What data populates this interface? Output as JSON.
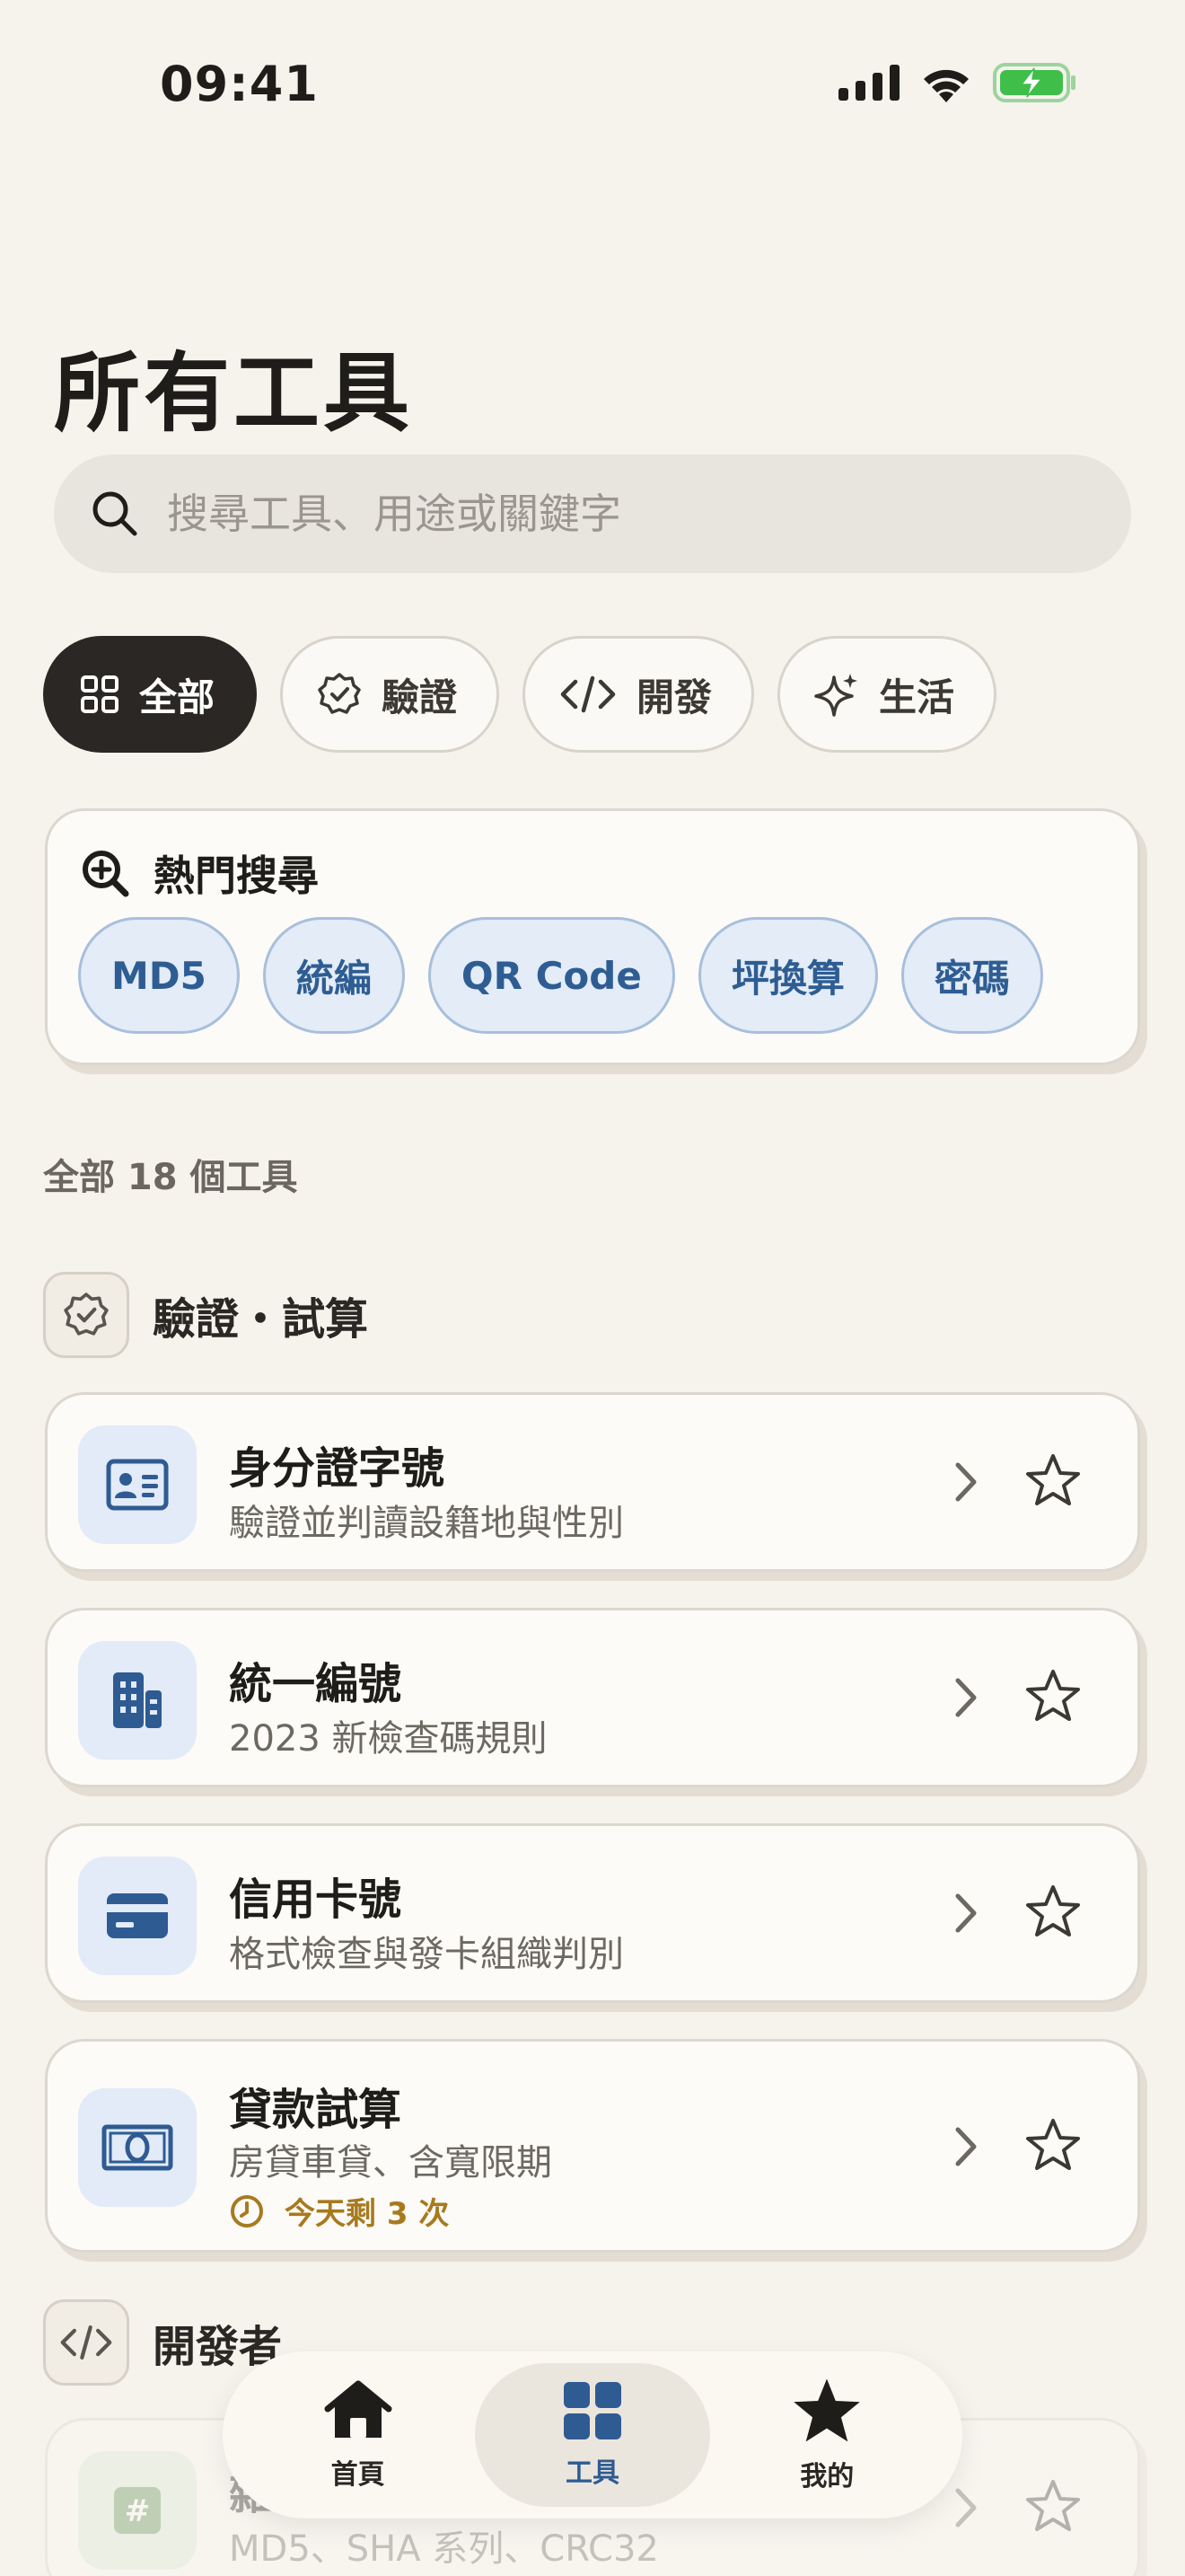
{
  "status": {
    "time": "09:41"
  },
  "page": {
    "title": "所有工具"
  },
  "search": {
    "placeholder": "搜尋工具、用途或關鍵字"
  },
  "filters": [
    {
      "label": "全部",
      "icon": "grid-icon",
      "active": true
    },
    {
      "label": "驗證",
      "icon": "badge-check-icon"
    },
    {
      "label": "開發",
      "icon": "code-icon"
    },
    {
      "label": "生活",
      "icon": "sparkle-icon"
    }
  ],
  "hot": {
    "title": "熱門搜尋",
    "tags": [
      "MD5",
      "統編",
      "QR Code",
      "坪換算",
      "密碼"
    ]
  },
  "count_label": "全部 18 個工具",
  "sections": [
    {
      "title": "驗證・試算",
      "tools": [
        {
          "title": "身分證字號",
          "subtitle": "驗證並判讀設籍地與性別",
          "icon": "id-card-icon"
        },
        {
          "title": "統一編號",
          "subtitle": "2023 新檢查碼規則",
          "icon": "building-icon"
        },
        {
          "title": "信用卡號",
          "subtitle": "格式檢查與發卡組織判別",
          "icon": "credit-card-icon"
        },
        {
          "title": "貸款試算",
          "subtitle": "房貸車貸、含寬限期",
          "quota": "今天剩 3 次",
          "icon": "banknote-icon"
        }
      ]
    },
    {
      "title": "開發者",
      "tools": [
        {
          "title": "雜湊產生",
          "subtitle": "MD5、SHA 系列、CRC32",
          "icon": "hash-icon"
        }
      ]
    }
  ],
  "tabs": [
    {
      "label": "首頁",
      "icon": "home-icon"
    },
    {
      "label": "工具",
      "icon": "apps-icon",
      "active": true
    },
    {
      "label": "我的",
      "icon": "star-icon"
    }
  ],
  "colors": {
    "accent": "#2f5b93",
    "quota": "#a77a1f",
    "background": "#f6f2ec"
  }
}
